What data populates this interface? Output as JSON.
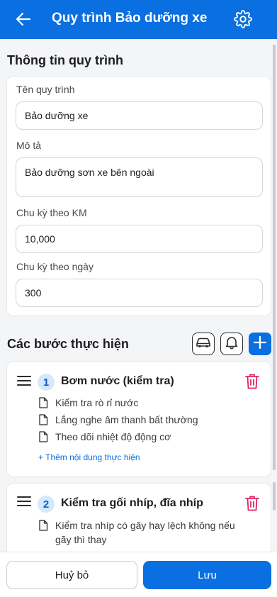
{
  "header": {
    "back_icon": "arrow-left-icon",
    "title": "Quy trình Bảo dưỡng xe",
    "settings_icon": "gear-icon",
    "background": "#0a6fe0"
  },
  "info_section": {
    "title": "Thông tin quy trình",
    "name_label": "Tên quy trình",
    "name_value": "Bảo dưỡng xe",
    "description_label": "Mô tả",
    "description_value": "Bảo dưỡng sơn xe bên ngoài",
    "km_label": "Chu kỳ theo KM",
    "km_value": "10,000",
    "days_label": "Chu kỳ theo ngày",
    "days_value": "300"
  },
  "steps_section": {
    "title": "Các bước thực hiện",
    "car_icon": "car-icon",
    "bell_icon": "bell-icon",
    "add_icon": "plus-icon",
    "steps": [
      {
        "number": "1",
        "title": "Bơm nước (kiểm tra)",
        "items": [
          "Kiểm tra rò rỉ nước",
          "Lắng nghe âm thanh bất thường",
          "Theo dõi nhiệt độ động cơ"
        ],
        "add_label": "+ Thêm nội dung thực hiện"
      },
      {
        "number": "2",
        "title": "Kiểm tra gối nhíp, đĩa nhíp",
        "items": [
          "Kiểm tra nhíp có gãy hay lệch không nếu gãy thì thay"
        ]
      }
    ]
  },
  "footer": {
    "cancel_label": "Huỷ bỏ",
    "save_label": "Lưu"
  },
  "colors": {
    "accent": "#0a6fe0",
    "danger": "#e0245e",
    "step_badge_bg": "#d6e8fb"
  }
}
